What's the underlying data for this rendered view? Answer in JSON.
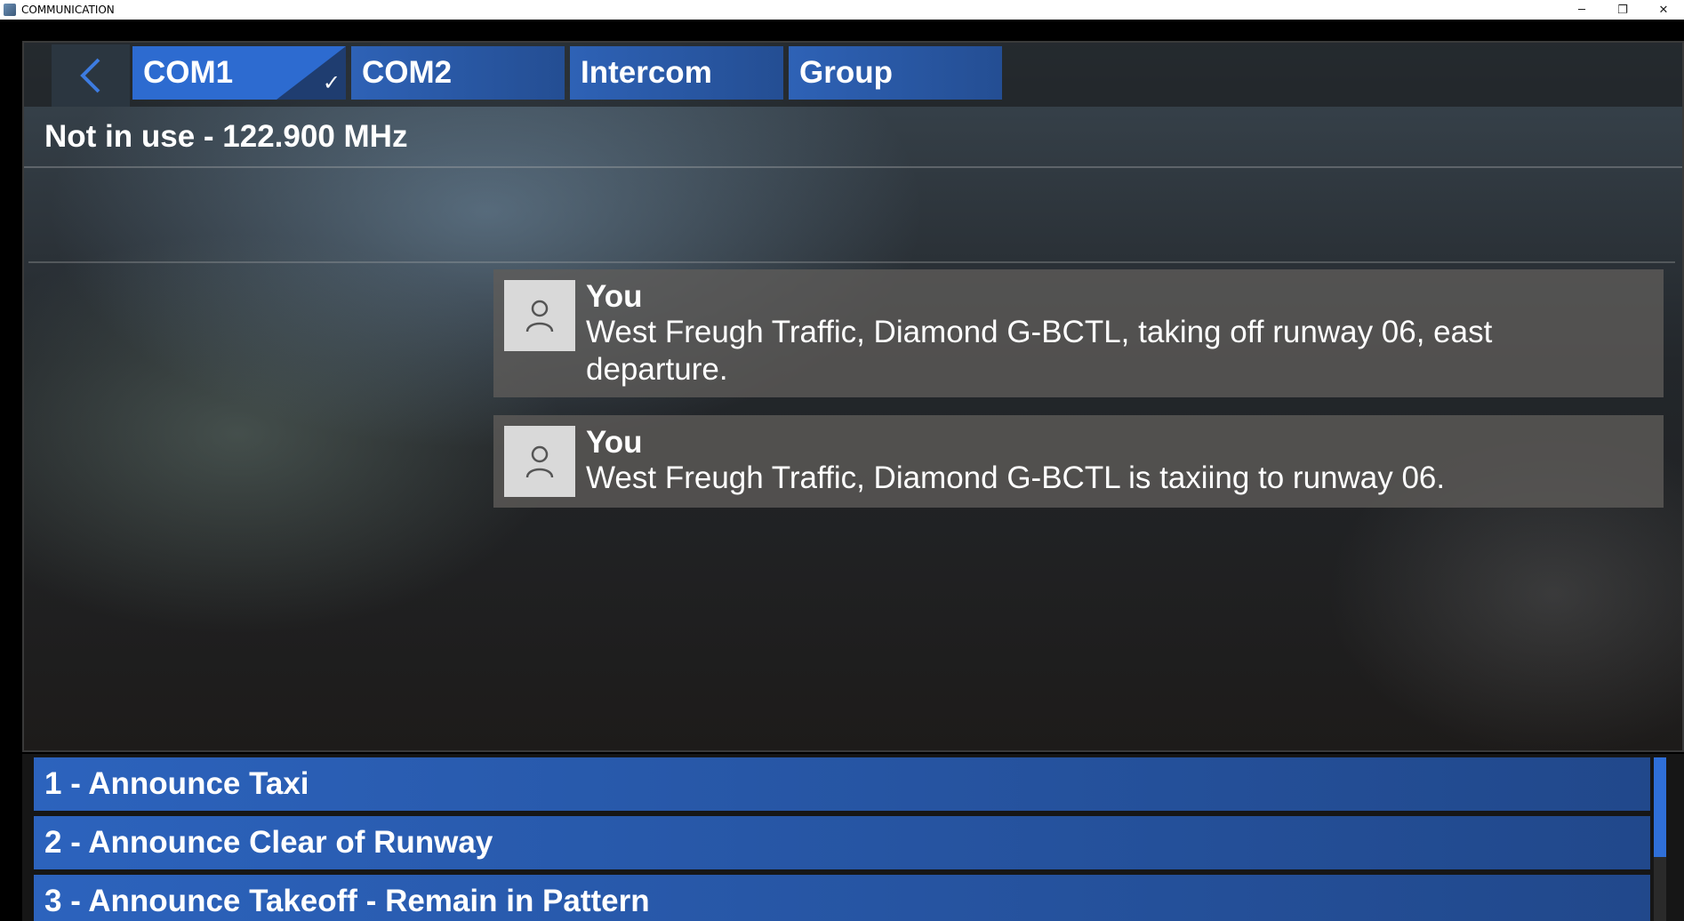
{
  "window": {
    "title": "COMMUNICATION",
    "controls": {
      "minimize": "─",
      "restore": "❐",
      "close": "✕"
    }
  },
  "tabs": [
    {
      "label": "COM1",
      "active": true
    },
    {
      "label": "COM2",
      "active": false
    },
    {
      "label": "Intercom",
      "active": false
    },
    {
      "label": "Group",
      "active": false
    }
  ],
  "active_check": "✓",
  "frequency_status": "Not in use - 122.900 MHz",
  "messages": [
    {
      "sender": "You",
      "text": "West Freugh Traffic, Diamond G-BCTL, taking off runway 06, east departure."
    },
    {
      "sender": "You",
      "text": "West Freugh Traffic, Diamond G-BCTL is taxiing to runway 06."
    }
  ],
  "options": [
    {
      "label": "1 - Announce Taxi"
    },
    {
      "label": "2 - Announce Clear of Runway"
    },
    {
      "label": "3 - Announce Takeoff - Remain in Pattern"
    }
  ],
  "icons": {
    "back": "chevron-left-icon",
    "avatar": "user-icon",
    "app": "app-icon"
  },
  "colors": {
    "tab_blue": "#2d6bd0",
    "option_blue": "#2c63bd",
    "back_chevron": "#3d7be0"
  }
}
